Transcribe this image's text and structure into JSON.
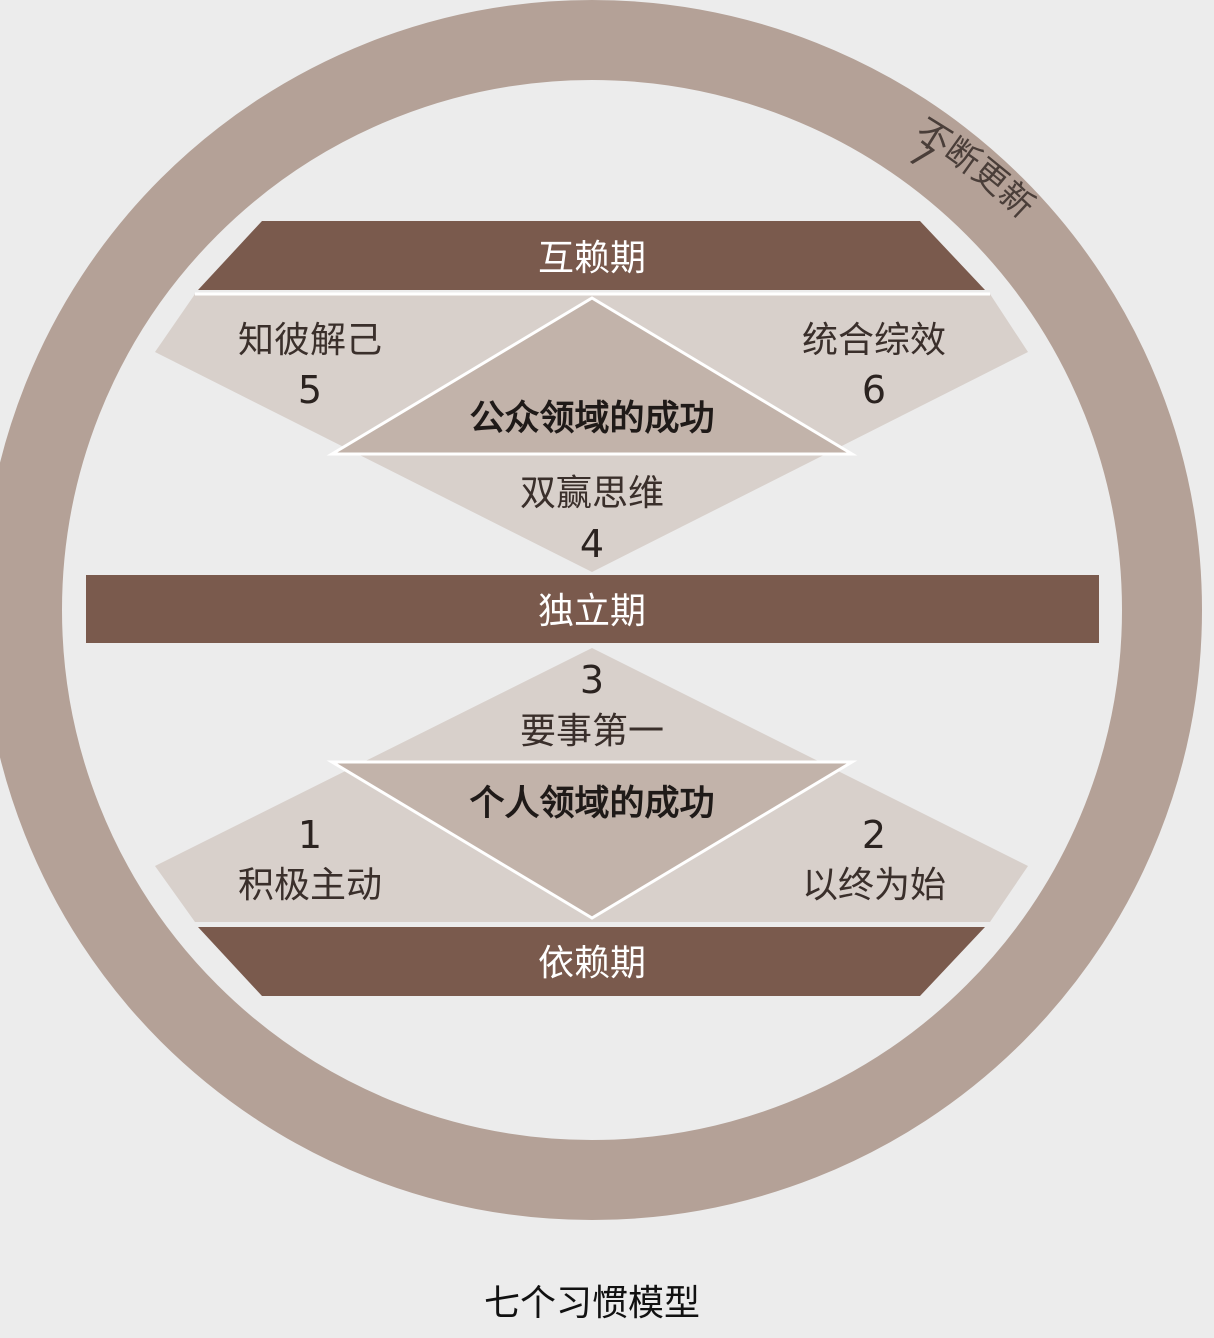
{
  "colors": {
    "background": "#ececec",
    "ring": "#b4a197",
    "band": "#7a5a4d",
    "light_panel": "#d8d0cb",
    "mid_diamond": "#c2b3aa",
    "dark_text": "#1f1a18"
  },
  "ring": {
    "number": "7",
    "label": "不断更新"
  },
  "bands": {
    "interdependence": "互赖期",
    "independence": "独立期",
    "dependence": "依赖期"
  },
  "public_victory": {
    "title": "公众领域的成功",
    "habit_5": {
      "label": "知彼解己",
      "number": "5"
    },
    "habit_6": {
      "label": "统合综效",
      "number": "6"
    },
    "habit_4": {
      "label": "双赢思维",
      "number": "4"
    }
  },
  "private_victory": {
    "title": "个人领域的成功",
    "habit_3": {
      "number": "3",
      "label": "要事第一"
    },
    "habit_1": {
      "number": "1",
      "label": "积极主动"
    },
    "habit_2": {
      "number": "2",
      "label": "以终为始"
    }
  },
  "caption": "七个习惯模型"
}
